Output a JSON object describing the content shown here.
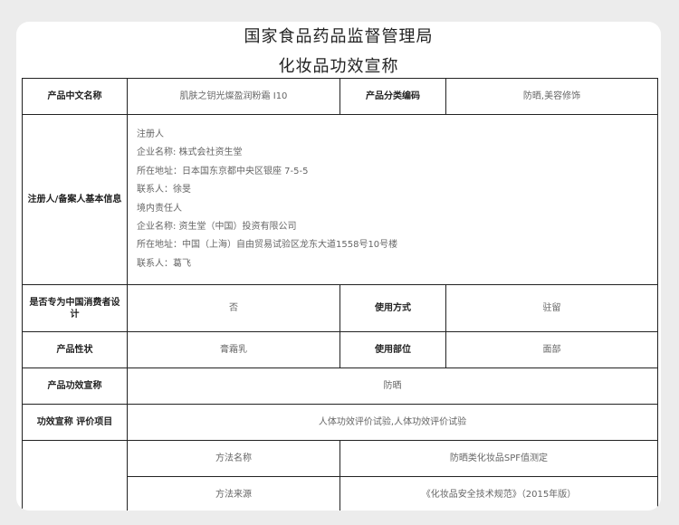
{
  "header": {
    "agency": "国家食品药品监督管理局",
    "doc_title": "化妆品功效宣称"
  },
  "rows": {
    "product_name": {
      "label": "产品中文名称",
      "value": "肌肤之钥光燦盈润粉霜 I10"
    },
    "category_code": {
      "label": "产品分类编码",
      "value": "防晒,美容修饰"
    },
    "registrant": {
      "label": "注册人/备案人基本信息",
      "lines": [
        "注册人",
        "企业名称: 株式会社资生堂",
        "所在地址：日本国东京都中央区银座 7-5-5",
        "联系人：徐旻",
        "境内责任人",
        "企业名称: 资生堂（中国）投资有限公司",
        "所在地址：中国（上海）自由贸易试验区龙东大道1558号10号楼",
        "联系人：葛飞"
      ]
    },
    "china_designed": {
      "label": "是否专为中国消费者设计",
      "value": "否"
    },
    "usage_method": {
      "label": "使用方式",
      "value": "驻留"
    },
    "product_form": {
      "label": "产品性状",
      "value": "膏霜乳"
    },
    "usage_area": {
      "label": "使用部位",
      "value": "面部"
    },
    "claim": {
      "label": "产品功效宣称",
      "value": "防晒"
    },
    "evaluation": {
      "label": "功效宣称 评价项目",
      "value": "人体功效评价试验,人体功效评价试验"
    },
    "method_name": {
      "label": "方法名称",
      "value": "防晒类化妆品SPF值测定"
    },
    "method_source": {
      "label": "方法来源",
      "value": "《化妆品安全技术规范》（2015年版）"
    }
  }
}
